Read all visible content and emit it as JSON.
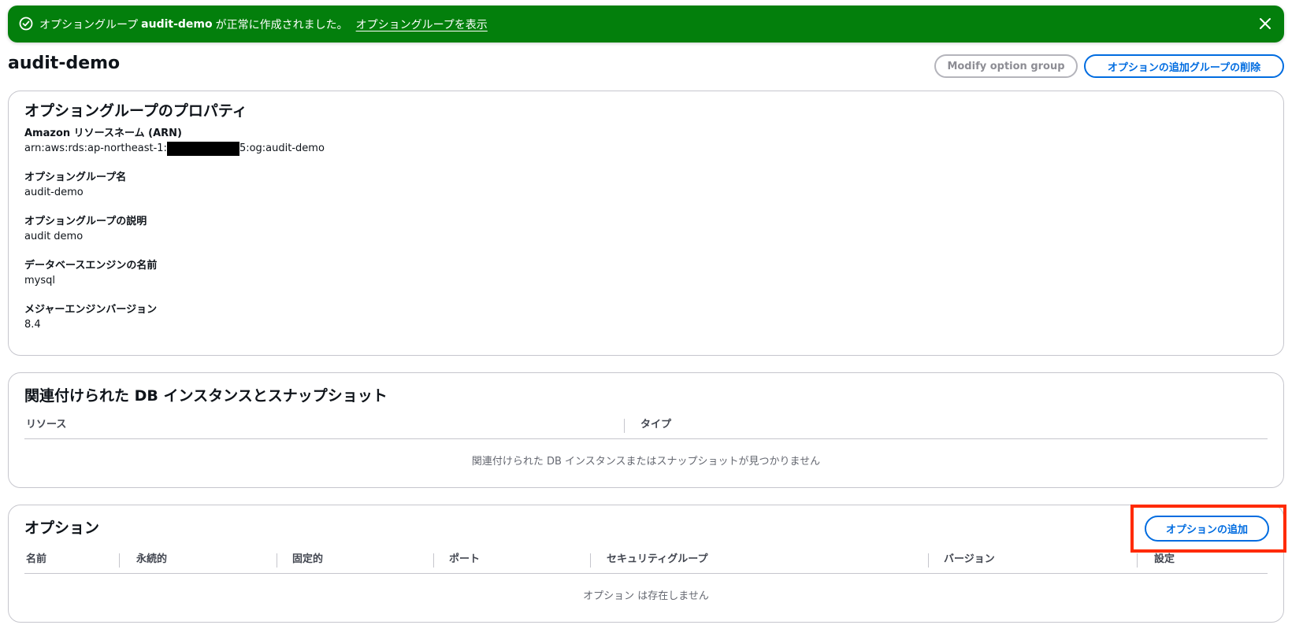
{
  "flash": {
    "prefix": "オプショングループ",
    "group_name": "audit-demo",
    "suffix": "が正常に作成されました。",
    "link": "オプショングループを表示"
  },
  "header": {
    "title": "audit-demo",
    "modify_label": "Modify option group",
    "delete_label": "オプションの追加グループの削除"
  },
  "properties": {
    "title": "オプショングループのプロパティ",
    "arn_label": "Amazon リソースネーム (ARN)",
    "arn_prefix": "arn:aws:rds:ap-northeast-1:",
    "arn_suffix": "5:og:audit-demo",
    "name_label": "オプショングループ名",
    "name_value": "audit-demo",
    "desc_label": "オプショングループの説明",
    "desc_value": "audit demo",
    "engine_label": "データベースエンジンの名前",
    "engine_value": "mysql",
    "version_label": "メジャーエンジンバージョン",
    "version_value": "8.4"
  },
  "associations": {
    "title": "関連付けられた DB インスタンスとスナップショット",
    "columns": [
      "リソース",
      "タイプ"
    ],
    "empty_text": "関連付けられた DB インスタンスまたはスナップショットが見つかりません"
  },
  "options": {
    "title": "オプション",
    "add_label": "オプションの追加",
    "columns": [
      "名前",
      "永続的",
      "固定的",
      "ポート",
      "セキュリティグループ",
      "バージョン",
      "設定"
    ],
    "empty_text": "オプション は存在しません"
  },
  "colors": {
    "success": "#037f0c",
    "primary": "#006ce0",
    "highlight": "#ff2a00"
  }
}
